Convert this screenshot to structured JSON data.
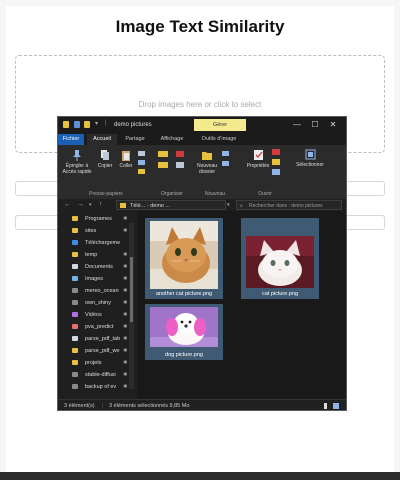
{
  "page": {
    "title": "Image Text Similarity",
    "dropzone_text": "Drop images here or click to select"
  },
  "explorer": {
    "window_title": "demo pictures",
    "manage_tab": "Gérer",
    "window_buttons": [
      "—",
      "☐",
      "✕"
    ],
    "tabs": [
      "Fichier",
      "Accueil",
      "Partage",
      "Affichage",
      "Outils d'image"
    ],
    "ribbon": {
      "buttons": [
        {
          "label_1": "Épingler à",
          "label_2": "Accès rapide",
          "icon": "pin-icon"
        },
        {
          "label_1": "Copier",
          "label_2": "",
          "icon": "copy-icon"
        },
        {
          "label_1": "Coller",
          "label_2": "",
          "icon": "paste-icon"
        },
        {
          "label_1": "Nouveau",
          "label_2": "dossier",
          "icon": "new-folder-icon"
        },
        {
          "label_1": "Propriétés",
          "label_2": "",
          "icon": "properties-icon"
        },
        {
          "label_1": "Sélectionner",
          "label_2": "",
          "icon": "select-icon"
        }
      ],
      "groups": [
        "Presse-papiers",
        "Organiser",
        "Nouveau",
        "Ouvrir"
      ]
    },
    "address": {
      "path_1": "Télé...",
      "path_2": "demo ...",
      "search_placeholder": "Rechercher dans : demo pictures"
    },
    "sidebar": {
      "items": [
        {
          "label": "Programes",
          "color": "#e6c13d"
        },
        {
          "label": "sites",
          "color": "#e6c13d"
        },
        {
          "label": "Téléchargeme",
          "color": "#3d8ee6"
        },
        {
          "label": "temp",
          "color": "#e6c13d"
        },
        {
          "label": "Documents",
          "color": "#cfd8e3"
        },
        {
          "label": "Images",
          "color": "#6fb4e6"
        },
        {
          "label": "mereo_ocean",
          "color": "#8a8a8a"
        },
        {
          "label": "own_shiny",
          "color": "#8a8a8a"
        },
        {
          "label": "Vidéos",
          "color": "#b36fe6"
        },
        {
          "label": "pva_predict",
          "color": "#e66f6f"
        },
        {
          "label": "parse_pdf_tab",
          "color": "#cfd8e3"
        },
        {
          "label": "parse_pdf_we",
          "color": "#e6c13d"
        },
        {
          "label": "projets",
          "color": "#e6c13d"
        },
        {
          "label": "stable-diffusi",
          "color": "#8a8a8a"
        },
        {
          "label": "backup of ev",
          "color": "#8a8a8a"
        }
      ]
    },
    "files": [
      {
        "name": "another cat picture.png",
        "kind": "orange-cat"
      },
      {
        "name": "cat picture.png",
        "kind": "white-cat"
      },
      {
        "name": "dog picture.png",
        "kind": "pink-dog"
      }
    ],
    "status": {
      "count": "3 élément(s)",
      "selection": "3 éléments sélectionnés  9,85 Mo"
    }
  }
}
